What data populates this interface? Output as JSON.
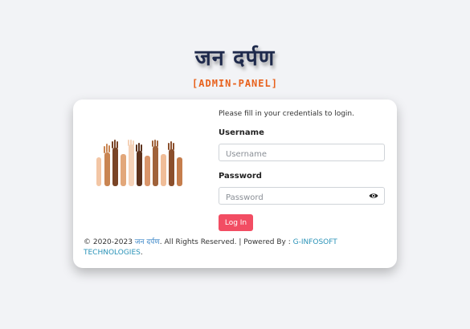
{
  "header": {
    "brand_title": "जन दर्पण",
    "subtitle": "[ADMIN-PANEL]"
  },
  "login": {
    "hint": "Please fill in your credentials to login.",
    "username_label": "Username",
    "username_placeholder": "Username",
    "username_value": "",
    "password_label": "Password",
    "password_placeholder": "Password",
    "password_value": "",
    "submit_label": "Log In"
  },
  "footer": {
    "prefix": "© 2020-2023 ",
    "brand": "जन दर्पण",
    "middle": ". All Rights Reserved. | Powered By : ",
    "company": "G-INFOSOFT TECHNOLOGIES",
    "suffix": "."
  },
  "icons": {
    "show_password": "eye-icon",
    "illustration": "raised-hands-illustration"
  },
  "colors": {
    "brand": "#1f2a4c",
    "subtitle": "#e8611c",
    "button": "#f24d63",
    "link": "#2a93b8"
  }
}
